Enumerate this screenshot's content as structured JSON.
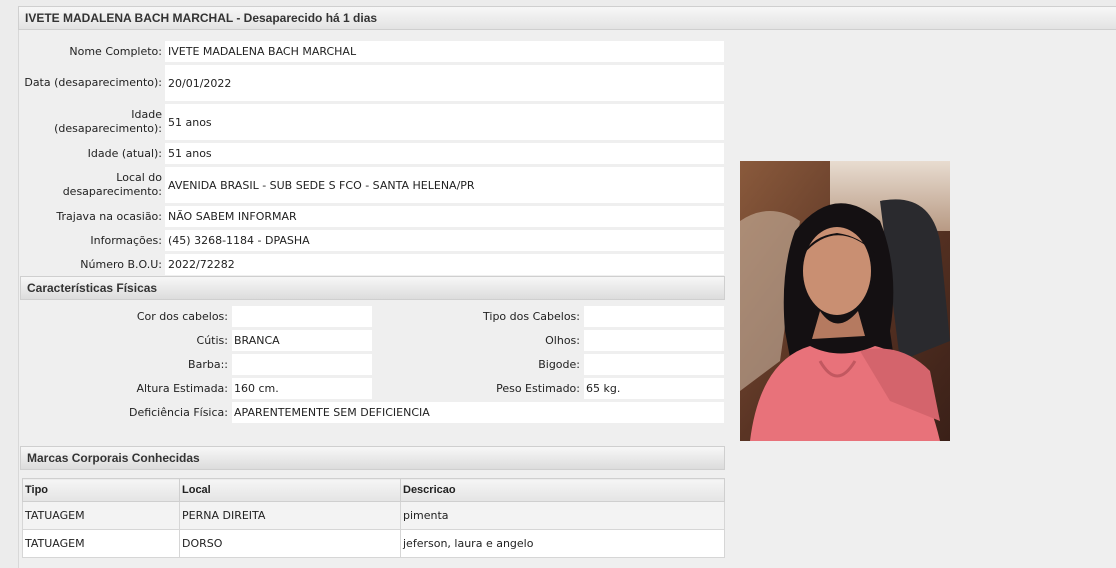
{
  "header": {
    "title": "IVETE MADALENA BACH MARCHAL - Desaparecido há  1 dias"
  },
  "info": [
    {
      "label": "Nome Completo:",
      "value": "IVETE MADALENA BACH MARCHAL"
    },
    {
      "label": "Data (desaparecimento):",
      "value": "20/01/2022"
    },
    {
      "label": "Idade (desaparecimento):",
      "value": "51 anos"
    },
    {
      "label": "Idade (atual):",
      "value": "51 anos"
    },
    {
      "label": "Local do desaparecimento:",
      "value": "AVENIDA BRASIL - SUB SEDE S FCO - SANTA HELENA/PR"
    },
    {
      "label": "Trajava na ocasião:",
      "value": "NÃO SABEM INFORMAR"
    },
    {
      "label": "Informações:",
      "value": "(45) 3268-1184 - DPASHA"
    },
    {
      "label": "Número B.O.U:",
      "value": "2022/72282"
    }
  ],
  "physical": {
    "title": "Características Físicas",
    "rows": [
      {
        "l1": "Cor dos cabelos:",
        "v1": "",
        "l2": "Tipo dos Cabelos:",
        "v2": ""
      },
      {
        "l1": "Cútis:",
        "v1": "BRANCA",
        "l2": "Olhos:",
        "v2": ""
      },
      {
        "l1": "Barba::",
        "v1": "",
        "l2": "Bigode:",
        "v2": ""
      },
      {
        "l1": "Altura Estimada:",
        "v1": "160 cm.",
        "l2": "Peso Estimado:",
        "v2": "65 kg."
      }
    ],
    "deficiency_label": "Deficiência Física:",
    "deficiency_value": "APARENTEMENTE SEM DEFICIENCIA"
  },
  "marks": {
    "title": "Marcas Corporais Conhecidas",
    "columns": [
      "Tipo",
      "Local",
      "Descricao"
    ],
    "rows": [
      [
        "TATUAGEM",
        "PERNA DIREITA",
        "pimenta"
      ],
      [
        "TATUAGEM",
        "DORSO",
        "jeferson, laura e angelo"
      ]
    ]
  }
}
